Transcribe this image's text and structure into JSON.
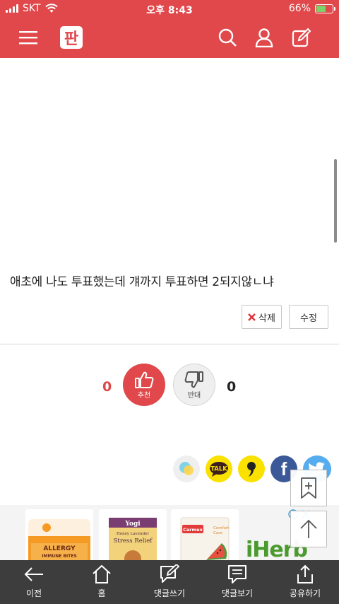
{
  "status_bar": {
    "carrier": "SKT",
    "time": "오후 8:43",
    "battery": "66%",
    "battery_level": 0.66
  },
  "header": {
    "logo_text": "판"
  },
  "post": {
    "content": "애초에 나도 투표했는데 걔까지 투표하면 2되지않ㄴ냐"
  },
  "actions": {
    "delete_label": "삭제",
    "edit_label": "수정"
  },
  "vote": {
    "up_count": "0",
    "up_label": "추천",
    "down_label": "반대",
    "down_count": "0"
  },
  "share": {
    "kakaotalk_label": "TALK",
    "facebook_label": "f"
  },
  "ad": {
    "brand": "iHerb",
    "items": [
      "ALLERGY IMMUNE BITES",
      "Yogi Stress Relief",
      "Carmex Comfort Care"
    ]
  },
  "toolbar": {
    "prev_label": "이전",
    "home_label": "홈",
    "write_comment_label": "댓글쓰기",
    "view_comment_label": "댓글보기",
    "share_label": "공유하기"
  },
  "colors": {
    "brand": "#e0484b",
    "toolbar": "#3d3d3d",
    "kakao": "#fae100",
    "facebook": "#3b5998",
    "twitter": "#55acee"
  }
}
